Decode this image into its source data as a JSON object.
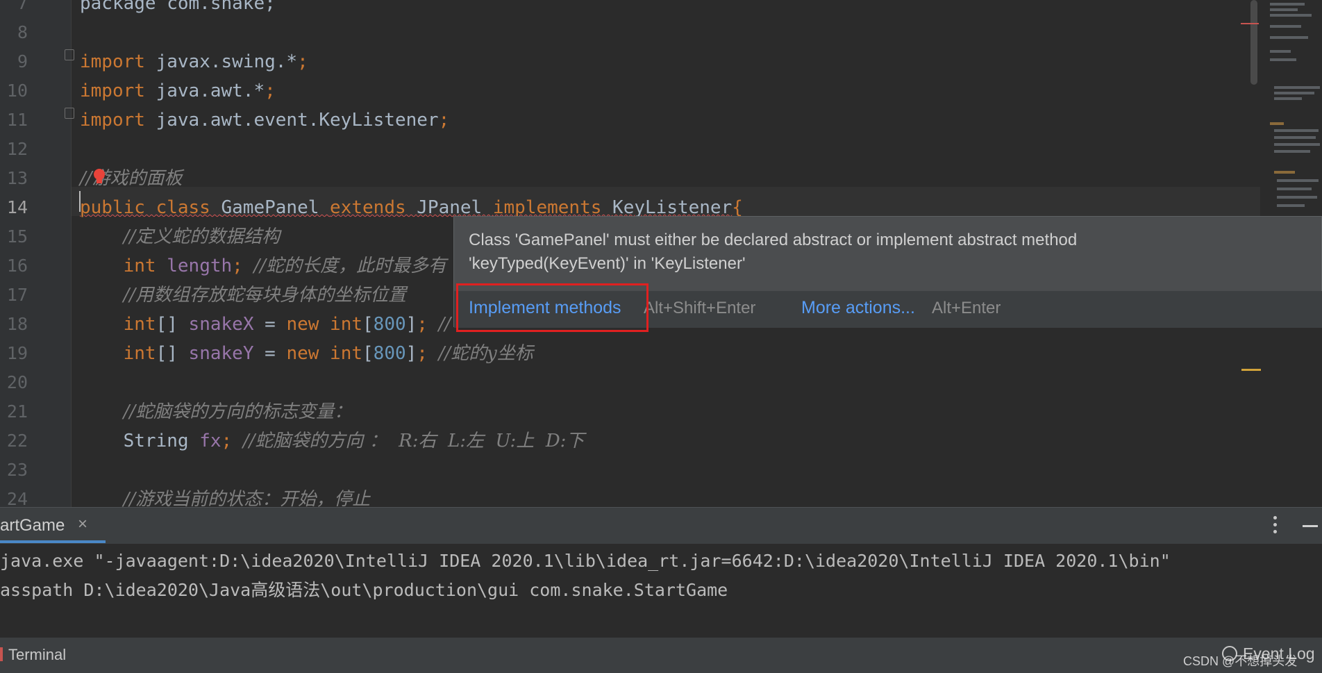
{
  "editor": {
    "line_numbers": [
      "7",
      "8",
      "9",
      "10",
      "11",
      "12",
      "13",
      "14",
      "15",
      "16",
      "17",
      "18",
      "19",
      "20",
      "21",
      "22",
      "23",
      "24"
    ],
    "current_line": "14",
    "lines": [
      [
        {
          "t": "package com.snake;",
          "c": "plain"
        }
      ],
      [],
      [
        {
          "t": "import ",
          "c": "kw"
        },
        {
          "t": "javax.swing.*",
          "c": "plain"
        },
        {
          "t": ";",
          "c": "kw"
        }
      ],
      [
        {
          "t": "import ",
          "c": "kw"
        },
        {
          "t": "java.awt.*",
          "c": "plain"
        },
        {
          "t": ";",
          "c": "kw"
        }
      ],
      [
        {
          "t": "import ",
          "c": "kw"
        },
        {
          "t": "java.awt.event.KeyListener",
          "c": "plain"
        },
        {
          "t": ";",
          "c": "kw"
        }
      ],
      [],
      [
        {
          "t": "//游戏的面板",
          "c": "cmt"
        }
      ],
      [
        {
          "t": "public class ",
          "c": "kw err"
        },
        {
          "t": "GamePanel ",
          "c": "plain err"
        },
        {
          "t": "extends ",
          "c": "kw err"
        },
        {
          "t": "JPanel ",
          "c": "plain err"
        },
        {
          "t": "implements ",
          "c": "kw err"
        },
        {
          "t": "KeyListener",
          "c": "plain err"
        },
        {
          "t": "{",
          "c": "kw"
        }
      ],
      [
        {
          "t": "    ",
          "c": "plain"
        },
        {
          "t": "//定义蛇的数据结构",
          "c": "cmt"
        }
      ],
      [
        {
          "t": "    int ",
          "c": "kw"
        },
        {
          "t": "length",
          "c": "field"
        },
        {
          "t": "; ",
          "c": "kw"
        },
        {
          "t": "//蛇的长度，此时最多有",
          "c": "cmt"
        }
      ],
      [
        {
          "t": "    ",
          "c": "plain"
        },
        {
          "t": "//用数组存放蛇每块身体的坐标位置",
          "c": "cmt"
        }
      ],
      [
        {
          "t": "    int",
          "c": "kw"
        },
        {
          "t": "[] ",
          "c": "plain"
        },
        {
          "t": "snakeX ",
          "c": "field"
        },
        {
          "t": "= ",
          "c": "plain"
        },
        {
          "t": "new int",
          "c": "kw"
        },
        {
          "t": "[",
          "c": "plain"
        },
        {
          "t": "800",
          "c": "num"
        },
        {
          "t": "]",
          "c": "plain"
        },
        {
          "t": "; ",
          "c": "kw"
        },
        {
          "t": "//",
          "c": "cmt"
        }
      ],
      [
        {
          "t": "    int",
          "c": "kw"
        },
        {
          "t": "[] ",
          "c": "plain"
        },
        {
          "t": "snakeY ",
          "c": "field"
        },
        {
          "t": "= ",
          "c": "plain"
        },
        {
          "t": "new int",
          "c": "kw"
        },
        {
          "t": "[",
          "c": "plain"
        },
        {
          "t": "800",
          "c": "num"
        },
        {
          "t": "]",
          "c": "plain"
        },
        {
          "t": "; ",
          "c": "kw"
        },
        {
          "t": "//蛇的y坐标",
          "c": "cmt"
        }
      ],
      [],
      [
        {
          "t": "    ",
          "c": "plain"
        },
        {
          "t": "//蛇脑袋的方向的标志变量：",
          "c": "cmt"
        }
      ],
      [
        {
          "t": "    String ",
          "c": "plain"
        },
        {
          "t": "fx",
          "c": "field"
        },
        {
          "t": "; ",
          "c": "kw"
        },
        {
          "t": "//蛇脑袋的方向 ：  R:右  L:左  U:上  D:下",
          "c": "cmt"
        }
      ],
      [],
      [
        {
          "t": "    ",
          "c": "plain"
        },
        {
          "t": "//游戏当前的状态：开始，停止",
          "c": "cmt"
        }
      ]
    ]
  },
  "popup": {
    "message_line1": "Class 'GamePanel' must either be declared abstract or implement abstract method",
    "message_line2": "'keyTyped(KeyEvent)' in 'KeyListener'",
    "primary_action": "Implement methods",
    "primary_shortcut": "Alt+Shift+Enter",
    "secondary_action": "More actions...",
    "secondary_shortcut": "Alt+Enter"
  },
  "run_panel": {
    "tab_label": "artGame",
    "close_glyph": "×"
  },
  "console": {
    "lines": [
      "java.exe \"-javaagent:D:\\idea2020\\IntelliJ IDEA 2020.1\\lib\\idea_rt.jar=6642:D:\\idea2020\\IntelliJ IDEA 2020.1\\bin\"",
      "asspath D:\\idea2020\\Java高级语法\\out\\production\\gui com.snake.StartGame"
    ]
  },
  "statusbar": {
    "terminal": "Terminal",
    "event_log": "Event Log",
    "watermark": "CSDN @不想掉头发"
  },
  "colors": {
    "background": "#2b2b2b",
    "keyword": "#cc7832",
    "field": "#9876aa",
    "number": "#6897bb",
    "comment": "#808080",
    "link": "#589df6",
    "highlight_box": "#e02020"
  }
}
